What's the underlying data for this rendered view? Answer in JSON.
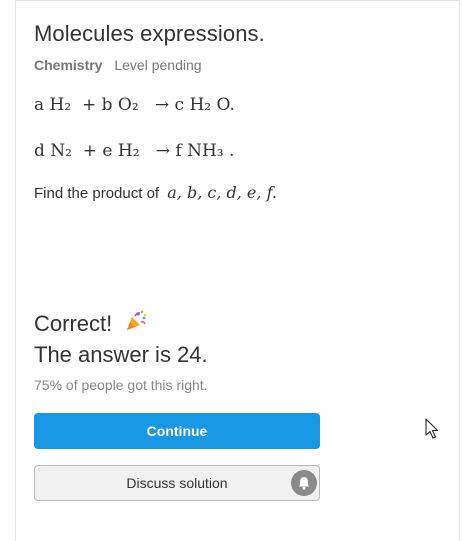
{
  "problem": {
    "title": "Molecules expressions.",
    "subject": "Chemistry",
    "level": "Level pending",
    "equation1": "a H₂  + b O₂   → c H₂ O.",
    "equation2": "d N₂  + e H₂   → f NH₃ .",
    "question_text": "Find the product of",
    "question_vars": "a, b, c, d, e, f."
  },
  "result": {
    "correct_label": "Correct!",
    "answer_text": "The answer is 24.",
    "stat_text": "75% of people got this right."
  },
  "buttons": {
    "continue_label": "Continue",
    "discuss_label": "Discuss solution"
  },
  "icons": {
    "celebration": "party-popper-icon",
    "discussion": "bell-icon",
    "pointer": "mouse-cursor-icon"
  },
  "colors": {
    "primary": "#1898e3",
    "text": "#333333",
    "muted": "#888888"
  }
}
